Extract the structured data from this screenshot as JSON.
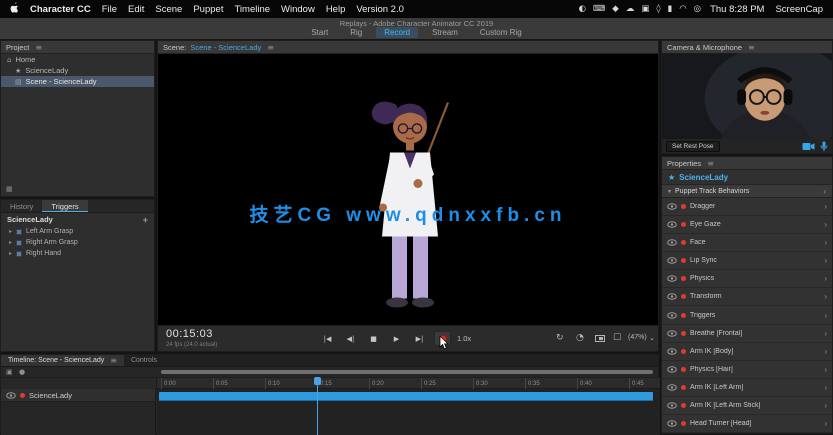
{
  "menubar": {
    "app_menu": "Character CC",
    "items": [
      "File",
      "Edit",
      "Scene",
      "Puppet",
      "Timeline",
      "Window",
      "Help",
      "Version 2.0"
    ],
    "clock": "Thu 8:28 PM",
    "screencap": "ScreenCap"
  },
  "titlebar": {
    "title": "Replays - Adobe Character Animator CC 2019",
    "tabs": [
      "Start",
      "Rig",
      "Record",
      "Stream",
      "Custom Rig"
    ],
    "active_tab": "Record"
  },
  "project": {
    "header": "Project",
    "home": "Home",
    "items": [
      {
        "label": "ScienceLady"
      },
      {
        "label": "Scene - ScienceLady"
      }
    ]
  },
  "history_triggers": {
    "tabs": [
      "History",
      "Triggers"
    ],
    "group": "ScienceLady",
    "items": [
      "Left Arm Grasp",
      "Right Arm Grasp",
      "Right Hand"
    ]
  },
  "scene": {
    "header_label": "Scene:",
    "header_name": "Scene - ScienceLady",
    "watermark": "技艺CG  www.qdnxxfb.cn",
    "timecode": "00:15:03",
    "fps": "24 fps (24.0 actual)",
    "speed": "1.0x",
    "zoom": "(47%)"
  },
  "camera": {
    "header": "Camera & Microphone",
    "set_rest_pose": "Set Rest Pose"
  },
  "properties": {
    "header": "Properties",
    "puppet": "ScienceLady",
    "section": "Puppet Track Behaviors",
    "behaviors": [
      "Dragger",
      "Eye Gaze",
      "Face",
      "Lip Sync",
      "Physics",
      "Transform",
      "Triggers",
      "Breathe [Frontal]",
      "Arm IK [Body]",
      "Physics [Hair]",
      "Arm IK [Left Arm]",
      "Arm IK [Left Arm Stick]",
      "Head Turner [Head]"
    ]
  },
  "timeline": {
    "tab": "Timeline: Scene - ScienceLady",
    "tab2": "Controls",
    "ruler": [
      "0:00",
      "0:05",
      "0:10",
      "0:15",
      "0:20",
      "0:25",
      "0:30",
      "0:35",
      "0:40",
      "0:45"
    ],
    "track": "ScienceLady"
  },
  "colors": {
    "accent": "#35a7e8",
    "record_red": "#e0302a",
    "clip_blue": "#2f9bdf"
  },
  "icons": {
    "panel_menu": "≡",
    "plus": "+",
    "disclosure": "▸",
    "section_collapse": "▾",
    "chevron_down": "⌄",
    "row_arrow": "›",
    "home": "⌂",
    "puppet_star": "★",
    "scene_glyph": "▤",
    "grid": "▦",
    "to_start": "|◀",
    "prev_frame": "◀|",
    "stop": "■",
    "play": "▶",
    "next_frame": "▶|",
    "loop": "↻",
    "timer": "◔",
    "checkbox": "☐",
    "cam_small": "▣",
    "dot": "●",
    "status": [
      "◐",
      "⌨",
      "◆",
      "☁",
      "▣",
      "◊",
      "▮",
      "◠",
      "◎"
    ]
  }
}
